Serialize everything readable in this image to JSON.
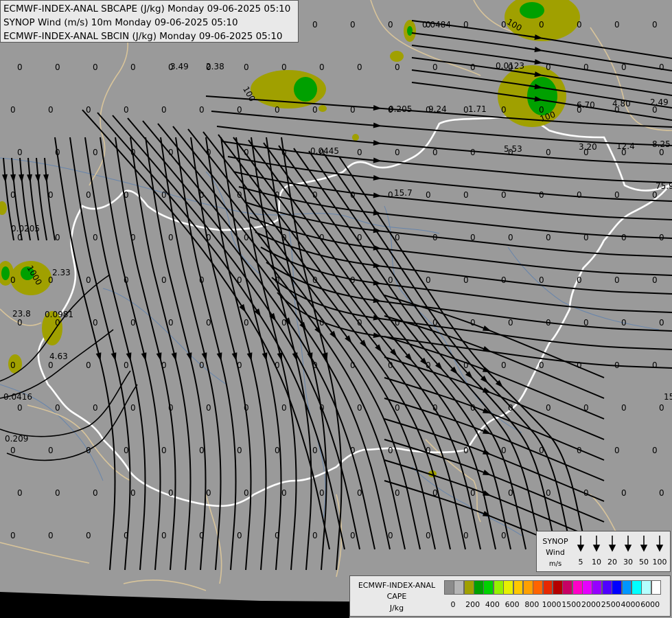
{
  "titles": [
    "ECMWF-INDEX-ANAL SBCAPE (J/kg) Monday 09-06-2025 05:10",
    "SYNOP Wind (m/s) 10m Monday 09-06-2025 05:10",
    "ECMWF-INDEX-ANAL SBCIN (J/kg) Monday 09-06-2025 05:10"
  ],
  "synop_legend": {
    "title_1": "SYNOP",
    "title_2": "Wind",
    "units": "m/s",
    "speeds": [
      "5",
      "10",
      "20",
      "30",
      "50",
      "100"
    ]
  },
  "cape_legend": {
    "title_1": "ECMWF-INDEX-ANAL",
    "title_2": "CAPE",
    "units": "J/kg",
    "colors": [
      "#8c8c8c",
      "#b4b4b4",
      "#a0a000",
      "#00a000",
      "#00d200",
      "#96f000",
      "#e6f000",
      "#ffc800",
      "#ffa000",
      "#ff6400",
      "#e62800",
      "#b40000",
      "#c80064",
      "#ff00c8",
      "#e600ff",
      "#9600ff",
      "#5000ff",
      "#0000ff",
      "#0096ff",
      "#00ffff",
      "#b4ffff",
      "#ffffff"
    ],
    "tick_labels": [
      "0",
      "200",
      "400",
      "600",
      "800",
      "1000",
      "1500",
      "2000",
      "2500",
      "4000",
      "6000"
    ]
  },
  "field_values": [
    "0.0484",
    "0.0123",
    "3.49",
    "2.38",
    "0.205",
    "9.24",
    "1.71",
    "6.70",
    "4.80",
    "2.49",
    "0.0445",
    "5.53",
    "3.20",
    "12.4",
    "8.25",
    "15.7",
    "0.0205",
    "2.33",
    "23.8",
    "0.0981",
    "4.63",
    "0.0416",
    "0.209",
    "75.9",
    "100",
    "100",
    "100",
    "1000",
    "0",
    "15"
  ]
}
